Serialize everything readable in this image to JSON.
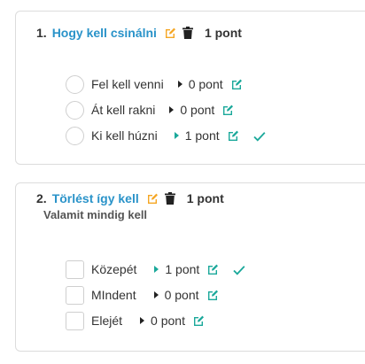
{
  "questions": [
    {
      "number": "1.",
      "title": "Hogy kell csinálni",
      "points": "1 pont",
      "description": "",
      "answers": [
        {
          "label": "Fel kell venni",
          "points": "0 pont",
          "correct": false
        },
        {
          "label": "Át kell rakni",
          "points": "0 pont",
          "correct": false
        },
        {
          "label": "Ki kell húzni",
          "points": "1 pont",
          "correct": true
        }
      ]
    },
    {
      "number": "2.",
      "title": "Törlést így kell",
      "points": "1 pont",
      "description": "Valamit mindig kell",
      "answers": [
        {
          "label": "Közepét",
          "points": "1 pont",
          "correct": true
        },
        {
          "label": "MIndent",
          "points": "0 pont",
          "correct": false
        },
        {
          "label": "Elejét",
          "points": "0 pont",
          "correct": false
        }
      ]
    }
  ],
  "colors": {
    "title": "#2a93c9",
    "edit_orange": "#f5a623",
    "edit_green": "#1aa89a",
    "correct_check": "#1aa89a"
  },
  "icons": {
    "edit": "pencil-square-icon",
    "delete": "trash-icon",
    "expand": "caret-right-icon",
    "correct": "check-icon"
  }
}
